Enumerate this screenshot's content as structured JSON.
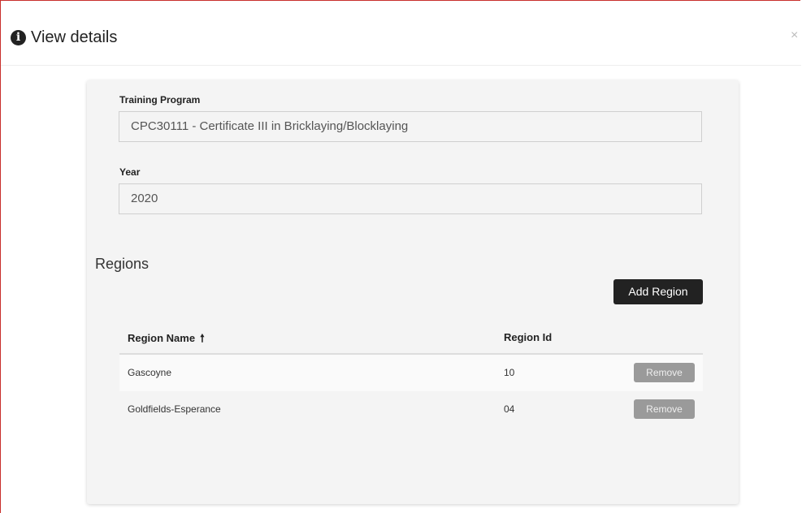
{
  "modal": {
    "title": "View details",
    "close_symbol": "×",
    "info_icon": "i"
  },
  "form": {
    "training_program": {
      "label": "Training Program",
      "value": "CPC30111 - Certificate III in Bricklaying/Blocklaying"
    },
    "year": {
      "label": "Year",
      "value": "2020"
    }
  },
  "regions": {
    "title": "Regions",
    "add_button_label": "Add Region",
    "columns": {
      "name": "Region Name",
      "id": "Region Id",
      "sort_icon": "🠕"
    },
    "rows": [
      {
        "name": "Gascoyne",
        "id": "10",
        "action": "Remove"
      },
      {
        "name": "Goldfields-Esperance",
        "id": "04",
        "action": "Remove"
      }
    ]
  },
  "colors": {
    "modal_border": "#c9302c",
    "primary_button": "#222222",
    "remove_button": "#9a9a9a"
  }
}
